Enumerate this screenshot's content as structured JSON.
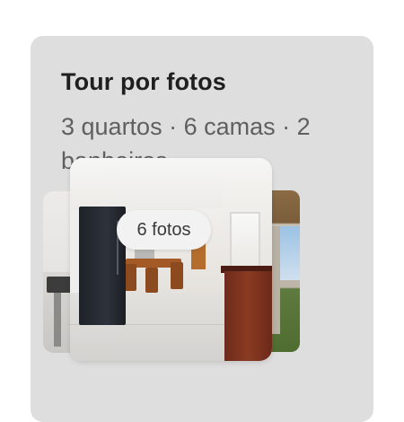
{
  "card": {
    "title": "Tour por fotos",
    "subtitle": "3 quartos · 6 camas · 2 banheiros",
    "photo_count_label": "6 fotos"
  },
  "colors": {
    "card_background": "#dedede",
    "title": "#1f1f1f",
    "subtitle": "#5f5f5f"
  }
}
